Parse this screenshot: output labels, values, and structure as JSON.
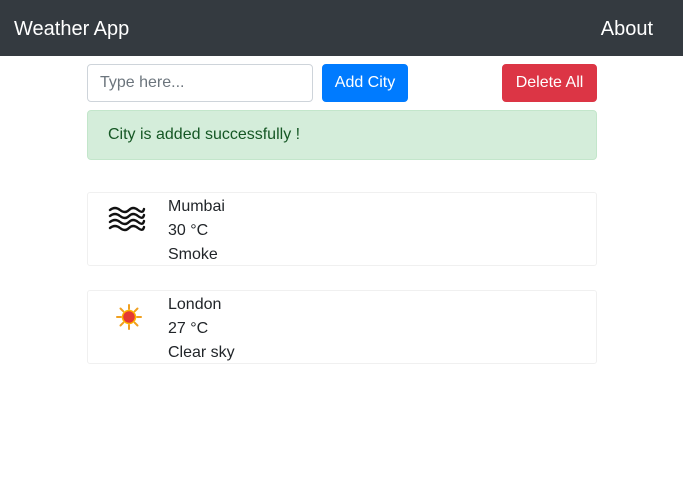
{
  "navbar": {
    "brand": "Weather App",
    "about": "About",
    "background_color": "#343a40"
  },
  "search": {
    "placeholder": "Type here...",
    "value": ""
  },
  "buttons": {
    "add_city": "Add City",
    "delete_all": "Delete All",
    "add_color": "#007bff",
    "delete_color": "#dc3545"
  },
  "alert": {
    "message": "City is added successfully !",
    "type": "success",
    "background_color": "#d4edda",
    "text_color": "#155724"
  },
  "cities": [
    {
      "name": "Mumbai",
      "temperature": "30 °C",
      "condition": "Smoke",
      "icon": "smoke-icon"
    },
    {
      "name": "London",
      "temperature": "27 °C",
      "condition": "Clear sky",
      "icon": "sun-icon"
    }
  ]
}
